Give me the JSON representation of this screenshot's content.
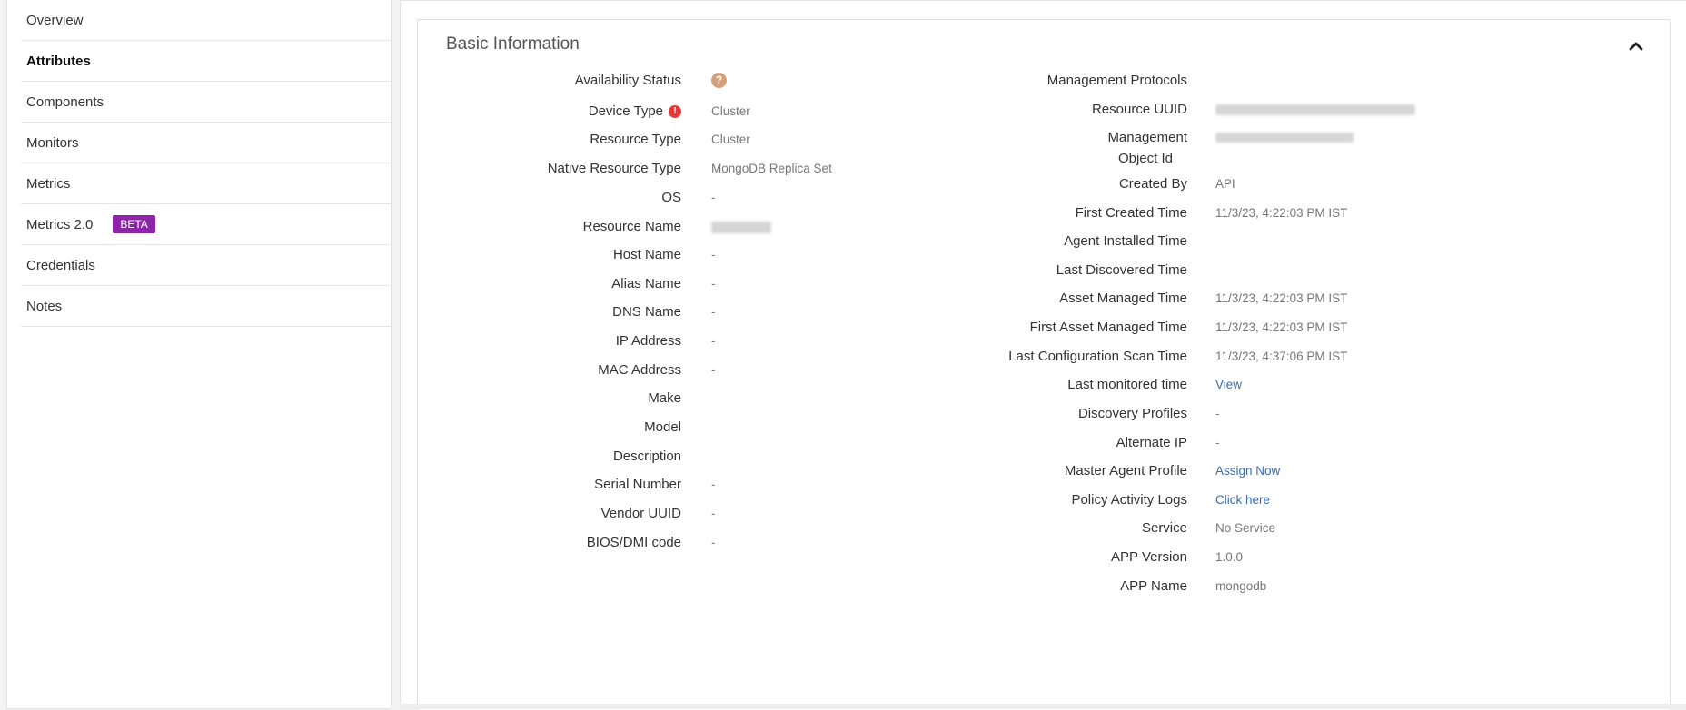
{
  "sidebar": {
    "items": [
      {
        "label": "Overview"
      },
      {
        "label": "Attributes"
      },
      {
        "label": "Components"
      },
      {
        "label": "Monitors"
      },
      {
        "label": "Metrics"
      },
      {
        "label": "Metrics 2.0",
        "badge": "BETA"
      },
      {
        "label": "Credentials"
      },
      {
        "label": "Notes"
      }
    ]
  },
  "panel": {
    "title": "Basic Information",
    "left": [
      {
        "label": "Availability Status",
        "value": ""
      },
      {
        "label": "Device Type",
        "value": "Cluster"
      },
      {
        "label": "Resource Type",
        "value": "Cluster"
      },
      {
        "label": "Native Resource Type",
        "value": "MongoDB Replica Set"
      },
      {
        "label": "OS",
        "value": "-"
      },
      {
        "label": "Resource Name",
        "value": ""
      },
      {
        "label": "Host Name",
        "value": "-"
      },
      {
        "label": "Alias Name",
        "value": "-"
      },
      {
        "label": "DNS Name",
        "value": "-"
      },
      {
        "label": "IP Address",
        "value": "-"
      },
      {
        "label": "MAC Address",
        "value": "-"
      },
      {
        "label": "Make",
        "value": ""
      },
      {
        "label": "Model",
        "value": ""
      },
      {
        "label": "Description",
        "value": ""
      },
      {
        "label": "Serial Number",
        "value": "-"
      },
      {
        "label": "Vendor UUID",
        "value": "-"
      },
      {
        "label": "BIOS/DMI code",
        "value": "-"
      }
    ],
    "right": [
      {
        "label": "Management Protocols",
        "value": ""
      },
      {
        "label": "Resource UUID",
        "value": ""
      },
      {
        "label": "Management",
        "label2": "Object Id",
        "value": ""
      },
      {
        "label": "Created By",
        "value": "API"
      },
      {
        "label": "First Created Time",
        "value": "11/3/23, 4:22:03 PM IST"
      },
      {
        "label": "Agent Installed Time",
        "value": ""
      },
      {
        "label": "Last Discovered Time",
        "value": ""
      },
      {
        "label": "Asset Managed Time",
        "value": "11/3/23, 4:22:03 PM IST"
      },
      {
        "label": "First Asset Managed Time",
        "value": "11/3/23, 4:22:03 PM IST"
      },
      {
        "label": "Last Configuration Scan Time",
        "value": "11/3/23, 4:37:06 PM IST"
      },
      {
        "label": "Last monitored time",
        "value": "View"
      },
      {
        "label": "Discovery Profiles",
        "value": "-"
      },
      {
        "label": "Alternate IP",
        "value": "-"
      },
      {
        "label": "Master Agent Profile",
        "value": "Assign Now"
      },
      {
        "label": "Policy Activity Logs",
        "value": "Click here"
      },
      {
        "label": "Service",
        "value": "No Service"
      },
      {
        "label": "APP Version",
        "value": "1.0.0"
      },
      {
        "label": "APP Name",
        "value": "mongodb"
      }
    ],
    "icons": {
      "availability": "question-icon",
      "device_type_alert": "alert-icon",
      "collapse": "chevron-up-icon"
    },
    "colors": {
      "beta": "#8e24aa",
      "link": "#3a6fb0",
      "alert": "#e53935",
      "help": "#d4a07c"
    }
  }
}
